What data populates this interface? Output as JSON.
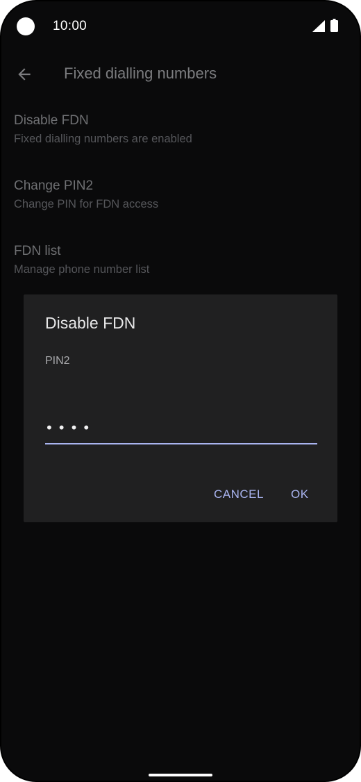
{
  "status_bar": {
    "time": "10:00",
    "icons": [
      "camera-cutout",
      "signal-icon",
      "battery-icon"
    ]
  },
  "app_bar": {
    "back_icon": "arrow-left-icon",
    "title": "Fixed dialling numbers"
  },
  "settings": {
    "items": [
      {
        "title": "Disable FDN",
        "summary": "Fixed dialling numbers are enabled"
      },
      {
        "title": "Change PIN2",
        "summary": "Change PIN for FDN access"
      },
      {
        "title": "FDN list",
        "summary": "Manage phone number list"
      }
    ]
  },
  "dialog": {
    "title": "Disable FDN",
    "message": "PIN2",
    "pin_value": "••••",
    "cancel_label": "CANCEL",
    "ok_label": "OK"
  },
  "colors": {
    "accent": "#aab5f1",
    "background": "#0a0a0b",
    "dialog_background": "#202021"
  }
}
